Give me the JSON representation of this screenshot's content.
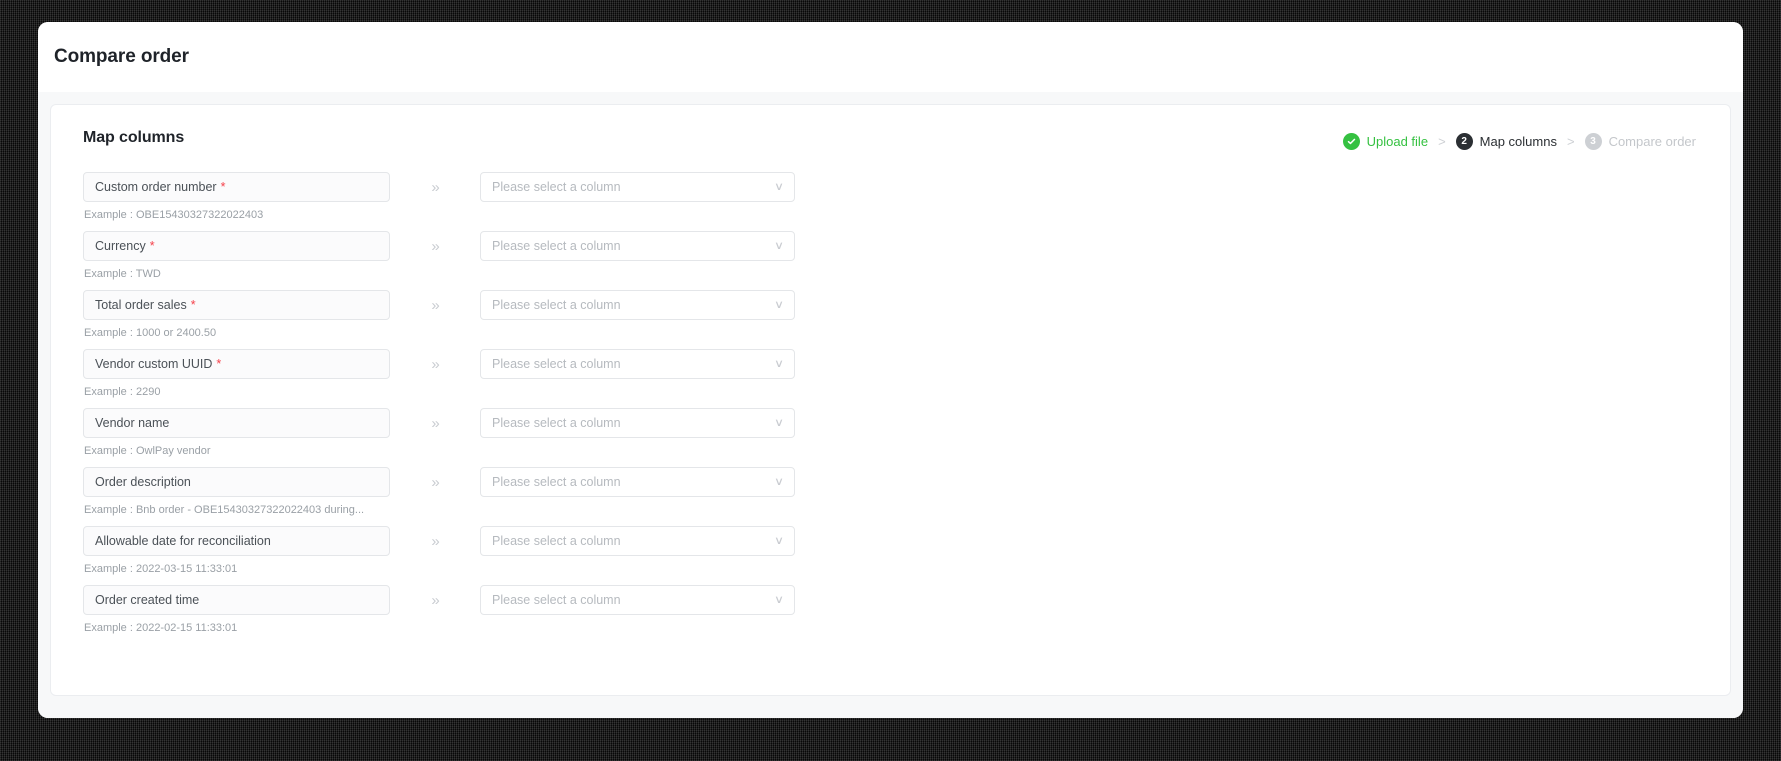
{
  "header": {
    "title": "Compare order"
  },
  "card": {
    "title": "Map columns"
  },
  "stepper": {
    "separator": ">",
    "steps": [
      {
        "badge": "check-icon",
        "number": "1",
        "label": "Upload file",
        "state": "done"
      },
      {
        "badge": "2",
        "number": "2",
        "label": "Map columns",
        "state": "active"
      },
      {
        "badge": "3",
        "number": "3",
        "label": "Compare order",
        "state": "todo"
      }
    ],
    "colors": {
      "done": "#35c141",
      "active": "#2b2f33",
      "todo": "#c4c7cb"
    }
  },
  "select_placeholder": "Please select a column",
  "required_marker": "*",
  "arrow_glyph": "»",
  "chevron_glyph": "∨",
  "rows": [
    {
      "label": "Custom order number",
      "required": true,
      "example": "Example : OBE15430327322022403",
      "selected": ""
    },
    {
      "label": "Currency",
      "required": true,
      "example": "Example : TWD",
      "selected": ""
    },
    {
      "label": "Total order sales",
      "required": true,
      "example": "Example : 1000 or 2400.50",
      "selected": ""
    },
    {
      "label": "Vendor custom UUID",
      "required": true,
      "example": "Example : 2290",
      "selected": ""
    },
    {
      "label": "Vendor name",
      "required": false,
      "example": "Example : OwlPay vendor",
      "selected": ""
    },
    {
      "label": "Order description",
      "required": false,
      "example": "Example : Bnb order - OBE15430327322022403 during...",
      "selected": ""
    },
    {
      "label": "Allowable date for reconciliation",
      "required": false,
      "example": "Example : 2022-03-15 11:33:01",
      "selected": ""
    },
    {
      "label": "Order created time",
      "required": false,
      "example": "Example : 2022-02-15 11:33:01",
      "selected": ""
    }
  ]
}
